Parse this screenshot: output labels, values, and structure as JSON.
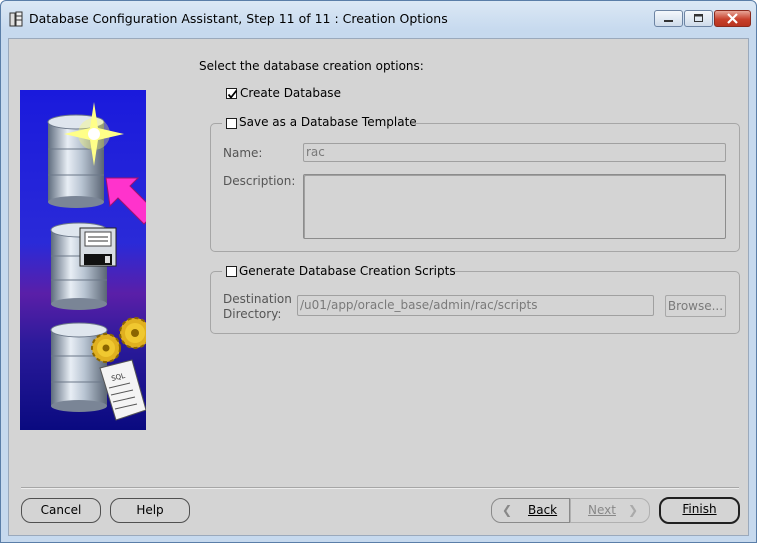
{
  "window": {
    "title": "Database Configuration Assistant, Step 11 of 11 : Creation Options",
    "controls": {
      "minimize": "minimize-icon",
      "maximize": "maximize-icon",
      "close": "close-icon"
    }
  },
  "intro": "Select the database creation options:",
  "create_database": {
    "label": "Create Database",
    "checked": true
  },
  "template": {
    "label": "Save as a Database Template",
    "checked": false,
    "name_label": "Name:",
    "name_value": "rac",
    "description_label": "Description:",
    "description_value": ""
  },
  "scripts": {
    "label": "Generate Database Creation Scripts",
    "checked": false,
    "dest_label_1": "Destination",
    "dest_label_2": "Directory:",
    "dest_value": "/u01/app/oracle_base/admin/rac/scripts",
    "browse_label": "Browse..."
  },
  "buttons": {
    "cancel": "Cancel",
    "help": "Help",
    "back": "Back",
    "next": "Next",
    "finish": "Finish"
  },
  "colors": {
    "accent_arrow": "#ff33cc",
    "panel_bg": "#d4d4d4",
    "title_bg": "#c6d9ee"
  }
}
